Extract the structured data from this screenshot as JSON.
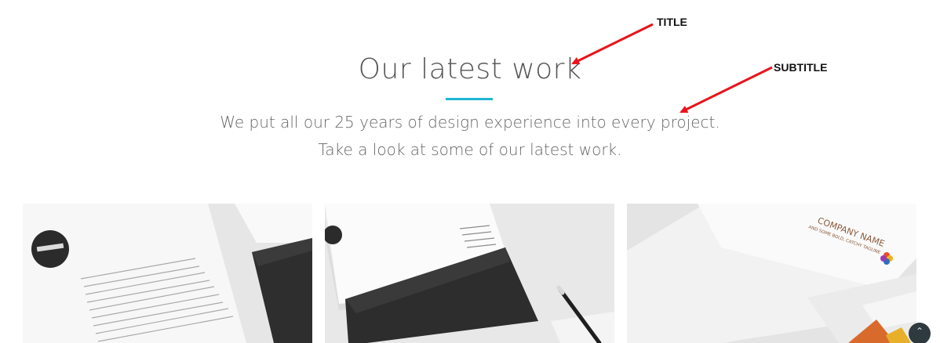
{
  "section": {
    "title": "Our latest work",
    "subtitle_line1": "We put all our 25 years of design experience into every project.",
    "subtitle_line2": "Take a look at some of our latest work."
  },
  "annotations": {
    "title_label": "TITLE",
    "subtitle_label": "SUBTITLE",
    "arrow_color": "#e8141b"
  },
  "portfolio": {
    "items": [
      {
        "thumbnail": "stationery-letterhead-mockup"
      },
      {
        "thumbnail": "envelope-folder-mockup"
      },
      {
        "thumbnail": "company-branding-mockup",
        "brand_text": "COMPANY NAME",
        "tagline": "AND SOME BOLD, CATCHY TAGLINE"
      }
    ]
  },
  "scroll_top": {
    "icon": "chevron-up-icon",
    "glyph": "⌃"
  },
  "colors": {
    "accent": "#1fb5d1",
    "text": "#555555"
  }
}
